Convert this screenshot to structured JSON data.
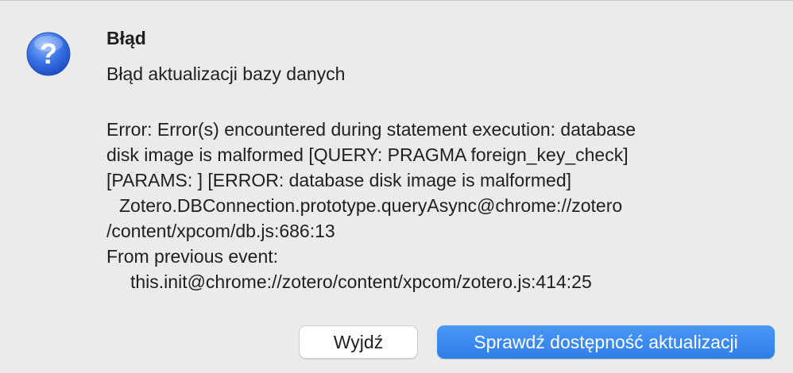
{
  "dialog": {
    "icon": "question-icon",
    "title": "Błąd",
    "subtitle": "Błąd aktualizacji bazy danych",
    "message_lines": [
      "Error: Error(s) encountered during statement execution: database",
      "disk image is malformed [QUERY: PRAGMA foreign_key_check]",
      "[PARAMS: ] [ERROR: database disk image is malformed]",
      "Zotero.DBConnection.prototype.queryAsync@chrome://zotero",
      "/content/xpcom/db.js:686:13",
      "From previous event:",
      "this.init@chrome://zotero/content/xpcom/zotero.js:414:25"
    ],
    "buttons": {
      "quit_label": "Wyjdź",
      "check_updates_label": "Sprawdź dostępność aktualizacji"
    }
  },
  "colors": {
    "background": "#ebebeb",
    "primary_button": "#3b8af0",
    "icon_blue": "#2f6fe0"
  }
}
